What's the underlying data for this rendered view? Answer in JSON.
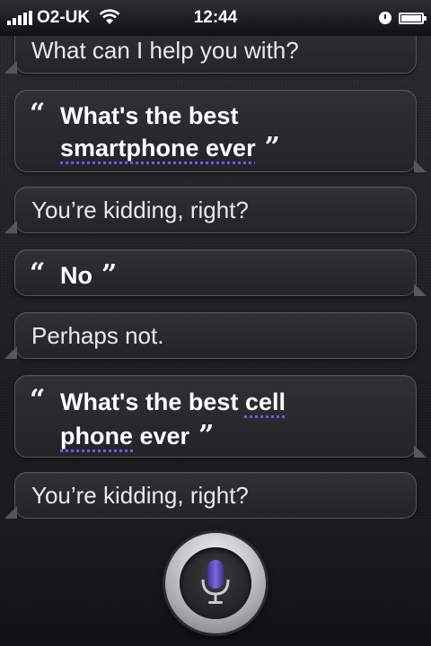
{
  "status_bar": {
    "carrier": "O2-UK",
    "time": "12:44"
  },
  "conversation": [
    {
      "speaker": "siri",
      "text": "What can I help you with?"
    },
    {
      "speaker": "user",
      "line1": "What's the best",
      "line2": "smartphone ever",
      "open_quote": "“",
      "close_quote": "”"
    },
    {
      "speaker": "siri",
      "text": "You’re kidding, right?"
    },
    {
      "speaker": "user",
      "line1": "No",
      "close_quote": "”",
      "open_quote": "“"
    },
    {
      "speaker": "siri",
      "text": "Perhaps not."
    },
    {
      "speaker": "user",
      "line1_a": "What's the best ",
      "line1_b": "cell",
      "line2_a": "phone",
      "line2_b": " ever",
      "open_quote": "“",
      "close_quote": "”"
    },
    {
      "speaker": "siri",
      "text": "You’re kidding, right?"
    }
  ],
  "controls": {
    "mic_icon": "microphone-icon"
  },
  "colors": {
    "mic_accent": "#5a4bb8",
    "underline": "#6a5cff"
  }
}
